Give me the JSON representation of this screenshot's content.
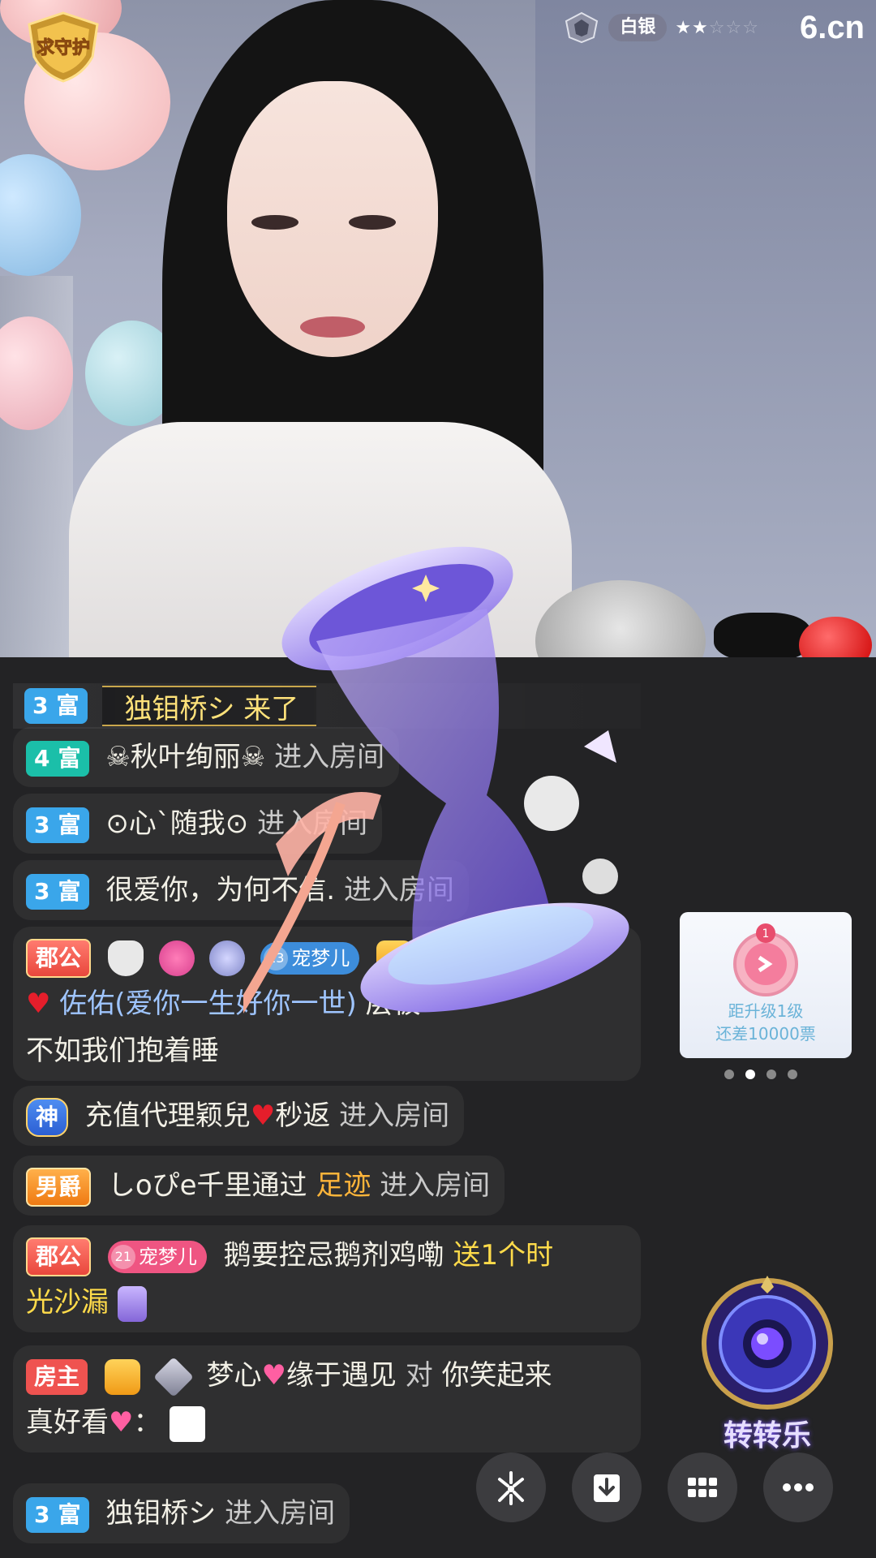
{
  "header": {
    "guard_badge": "求守护",
    "rank_label": "白银",
    "stars_filled": 2,
    "stars_total": 5,
    "site_logo": "6.cn"
  },
  "arrival": {
    "rich_level": "3",
    "rich_label": "富",
    "text": "独钼桥シ 来了"
  },
  "messages": [
    {
      "rich_level": "4",
      "rich_label": "富",
      "name": "☠秋叶绚丽☠",
      "action": "进入房间"
    },
    {
      "rich_level": "3",
      "rich_label": "富",
      "name": "⊙心`随我⊙",
      "action": "进入房间"
    },
    {
      "rich_level": "3",
      "rich_label": "富",
      "name": "很爱你，为何不信.",
      "action": "进入房间"
    },
    {
      "role": "郡公",
      "fan_level": "13",
      "fan_name": "宠梦儿",
      "name": "佐佑(爱你一生好你一世)",
      "text_end": "层被",
      "line2": "不如我们抱着睡"
    },
    {
      "role": "神",
      "name": "充值代理颖兒",
      "name_tail": "秒返",
      "action": "进入房间"
    },
    {
      "role": "男爵",
      "name": "しoぴe千里通过",
      "highlight": "足迹",
      "action": "进入房间"
    },
    {
      "role": "郡公",
      "fan_level": "21",
      "fan_name": "宠梦儿",
      "name": "鹅要控忌鹅剂鸡嘞",
      "gift_text": "送1个时",
      "gift_line2": "光沙漏"
    },
    {
      "role": "房主",
      "name": "梦心",
      "name_tail": "缘于遇见",
      "verb": "对",
      "text": "你笑起来",
      "line2": "真好看",
      "punct": "："
    },
    {
      "rich_level": "3",
      "rich_label": "富",
      "name": "独钼桥シ",
      "action": "进入房间"
    }
  ],
  "level_card": {
    "level_badge": "1",
    "line1": "距升级1级",
    "line2": "还差10000票"
  },
  "pager": {
    "count": 4,
    "active": 1
  },
  "wheel": {
    "label": "转转乐"
  },
  "buttons": [
    "share-button",
    "download-button",
    "menu-grid-button",
    "more-button"
  ],
  "colors": {
    "background": "#232325",
    "rich_blue": "#3aa6ea",
    "rich_teal": "#1bbfa9",
    "gift_yellow": "#ffdb4a",
    "footprint_orange": "#ffb53a"
  }
}
